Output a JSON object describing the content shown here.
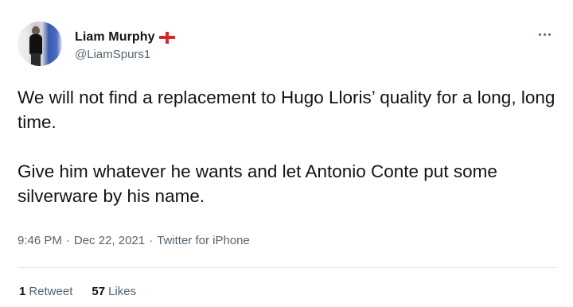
{
  "author": {
    "display_name": "Liam Murphy",
    "handle": "@LiamSpurs1",
    "flag": "england-flag-icon"
  },
  "menu_icon": "more-options-icon",
  "tweet": {
    "paragraphs": [
      "We will not find a replacement to Hugo Lloris’ quality for a long, long time.",
      "Give him whatever he wants and let Antonio Conte put some silverware by his name."
    ]
  },
  "meta": {
    "time": "9:46 PM",
    "separator": "·",
    "date": "Dec 22, 2021",
    "source": "Twitter for iPhone"
  },
  "stats": {
    "retweets_count": "1",
    "retweets_label": "Retweet",
    "likes_count": "57",
    "likes_label": "Likes"
  },
  "colors": {
    "text_primary": "#0f1419",
    "text_secondary": "#536471",
    "flag_red": "#d62828",
    "divider": "#e1e6ea"
  }
}
